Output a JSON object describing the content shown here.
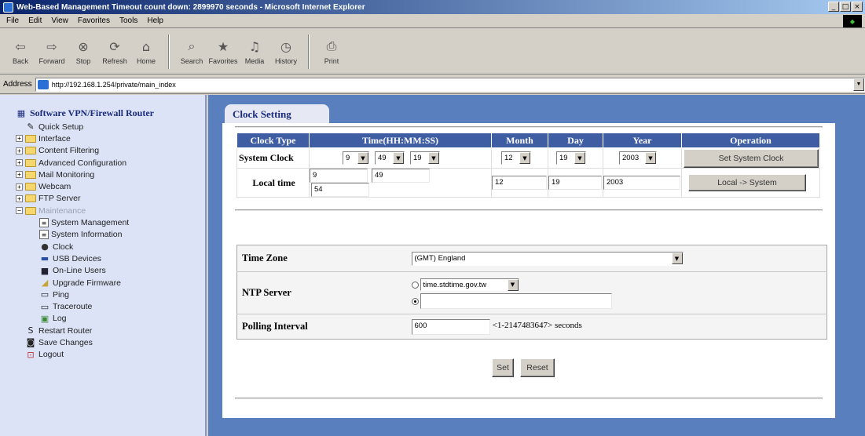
{
  "window": {
    "title": "Web-Based Management Timeout count down: 2899970 seconds - Microsoft Internet Explorer",
    "controls": [
      "_",
      "□",
      "×"
    ]
  },
  "menu": [
    "File",
    "Edit",
    "View",
    "Favorites",
    "Tools",
    "Help"
  ],
  "toolbar": {
    "back": "Back",
    "forward": "Forward",
    "stop": "Stop",
    "refresh": "Refresh",
    "home": "Home",
    "search": "Search",
    "favorites": "Favorites",
    "media": "Media",
    "history": "History",
    "print": "Print"
  },
  "address": {
    "label": "Address",
    "url": "http://192.168.1.254/private/main_index"
  },
  "nav": {
    "root": "Software VPN/Firewall Router",
    "items": [
      {
        "label": "Quick Setup"
      },
      {
        "label": "Interface"
      },
      {
        "label": "Content Filtering"
      },
      {
        "label": "Advanced Configuration"
      },
      {
        "label": "Mail Monitoring"
      },
      {
        "label": "Webcam"
      },
      {
        "label": "FTP Server"
      },
      {
        "label": "Maintenance"
      }
    ],
    "sub": [
      {
        "label": "System Management"
      },
      {
        "label": "System Information"
      },
      {
        "label": "Clock"
      },
      {
        "label": "USB Devices"
      },
      {
        "label": "On-Line Users"
      },
      {
        "label": "Upgrade Firmware"
      },
      {
        "label": "Ping"
      },
      {
        "label": "Traceroute"
      },
      {
        "label": "Log"
      }
    ],
    "bottom": [
      {
        "label": "Restart Router"
      },
      {
        "label": "Save Changes"
      },
      {
        "label": "Logout"
      }
    ]
  },
  "page": {
    "tab": "Clock Setting",
    "clock": {
      "headers": {
        "type": "Clock Type",
        "time": "Time(HH:MM:SS)",
        "month": "Month",
        "day": "Day",
        "year": "Year",
        "op": "Operation"
      },
      "system": {
        "label": "System Clock",
        "hh": "9",
        "mm": "49",
        "ss": "19",
        "month": "12",
        "day": "19",
        "year": "2003",
        "button": "Set System Clock"
      },
      "local": {
        "label": "Local time",
        "hh": "9",
        "mm": "49",
        "ss": "54",
        "month": "12",
        "day": "19",
        "year": "2003",
        "button": "Local -> System"
      }
    },
    "settings": {
      "timezone_label": "Time Zone",
      "timezone_value": "(GMT) England",
      "ntp_label": "NTP Server",
      "ntp_option": "time.stdtime.gov.tw",
      "ntp_custom": "",
      "poll_label": "Polling Interval",
      "poll_value": "600",
      "poll_hint": "<1-2147483647> seconds"
    },
    "buttons": {
      "set": "Set",
      "reset": "Reset"
    }
  }
}
